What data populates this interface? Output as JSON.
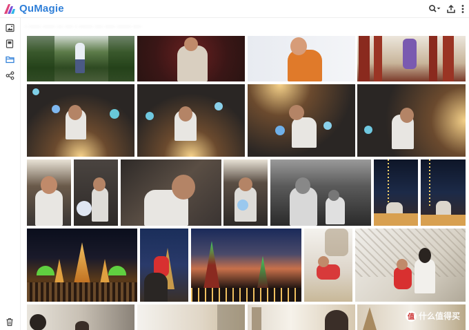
{
  "app": {
    "name": "QuMagie"
  },
  "header": {
    "icons": [
      "search-icon",
      "upload-icon",
      "more-icon"
    ]
  },
  "sidebar": {
    "items": [
      "photos-icon",
      "albums-icon",
      "folders-icon",
      "share-icon"
    ],
    "bottom": "trash-icon"
  },
  "path": {
    "text": "· ······ ······ ··· ···· · ······· ···· ····· ······· ····"
  },
  "colors": {
    "accent": "#2f7fd8",
    "folder_active": "#2f7fd8"
  },
  "watermark": {
    "text": "什么值得买",
    "badge": "值"
  }
}
